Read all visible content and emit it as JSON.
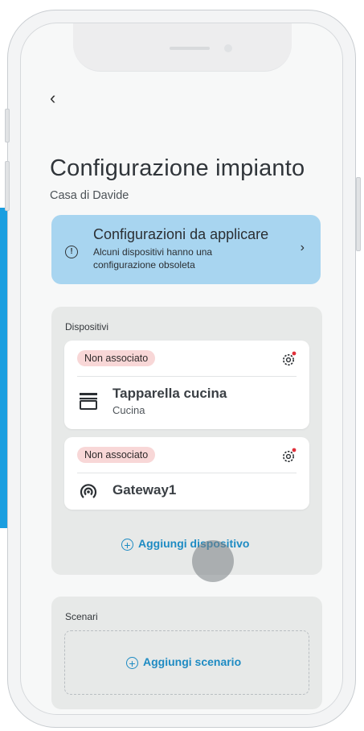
{
  "header": {
    "back_icon": "chevron-left-icon",
    "title": "Configurazione impianto",
    "subtitle": "Casa di Davide"
  },
  "banner": {
    "icon": "alert-circle-icon",
    "title": "Configurazioni da applicare",
    "description": "Alcuni dispositivi hanno una configurazione obsoleta",
    "chevron_icon": "chevron-right-icon",
    "background": "#a8d5f0"
  },
  "devices": {
    "label": "Dispositivi",
    "items": [
      {
        "status": "Non associato",
        "name": "Tapparella cucina",
        "room": "Cucina",
        "icon": "shutter-icon",
        "settings_icon": "gear-alert-icon"
      },
      {
        "status": "Non associato",
        "name": "Gateway1",
        "room": "",
        "icon": "gateway-icon",
        "settings_icon": "gear-alert-icon"
      }
    ],
    "add_label": "Aggiungi dispositivo"
  },
  "scenari": {
    "label": "Scenari",
    "add_label": "Aggiungi scenario"
  },
  "colors": {
    "accent": "#1e8bc3",
    "badge": "#f8d7d7",
    "alert_dot": "#e0303a"
  }
}
